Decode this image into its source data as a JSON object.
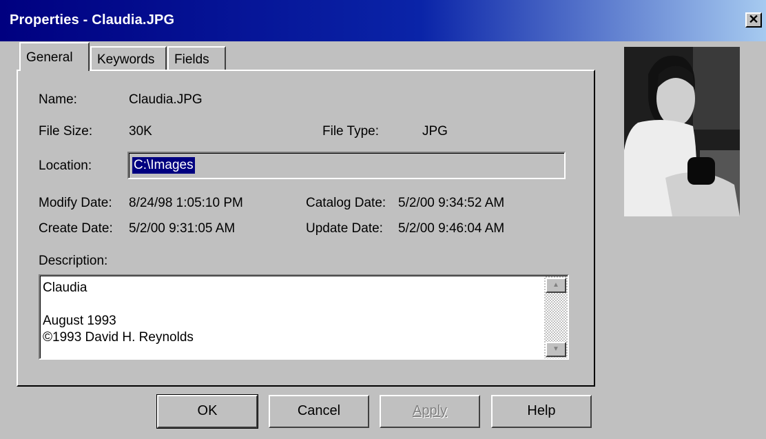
{
  "window": {
    "title": "Properties - Claudia.JPG",
    "close_glyph": "✕"
  },
  "tabs": [
    {
      "label": "General",
      "active": true
    },
    {
      "label": "Keywords",
      "active": false
    },
    {
      "label": "Fields",
      "active": false
    }
  ],
  "general": {
    "name_label": "Name:",
    "name_value": "Claudia.JPG",
    "filesize_label": "File Size:",
    "filesize_value": "30K",
    "filetype_label": "File Type:",
    "filetype_value": "JPG",
    "location_label": "Location:",
    "location_value": "C:\\Images",
    "modify_label": "Modify Date:",
    "modify_value": "8/24/98 1:05:10 PM",
    "catalog_label": "Catalog Date:",
    "catalog_value": "5/2/00 9:34:52 AM",
    "create_label": "Create Date:",
    "create_value": "5/2/00 9:31:05 AM",
    "update_label": "Update Date:",
    "update_value": "5/2/00 9:46:04 AM",
    "description_label": "Description:",
    "description_text": "Claudia\n\nAugust 1993\n©1993 David H. Reynolds"
  },
  "buttons": {
    "ok": "OK",
    "cancel": "Cancel",
    "apply": "Apply",
    "help": "Help"
  },
  "icons": {
    "scroll_up": "▲",
    "scroll_down": "▼"
  }
}
